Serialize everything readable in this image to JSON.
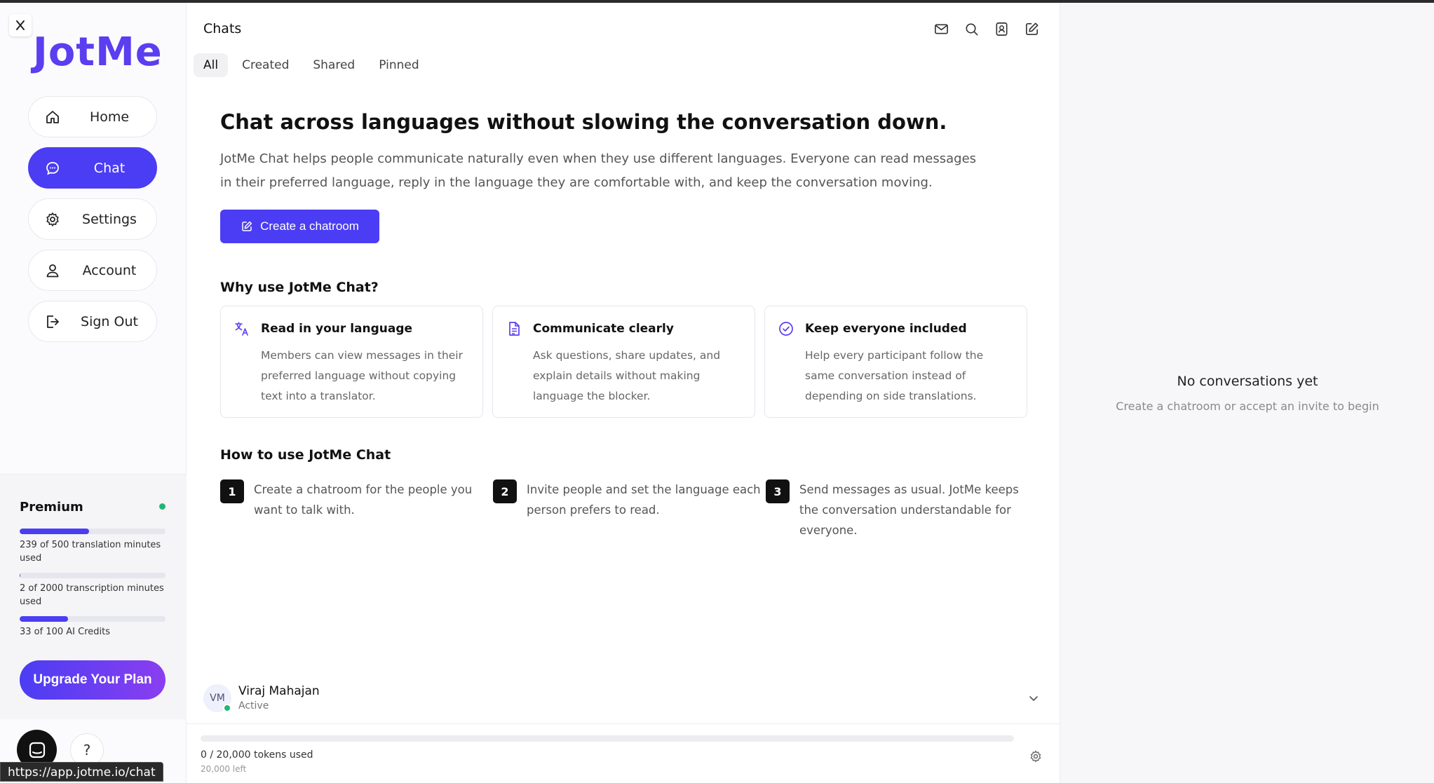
{
  "sidebar": {
    "logo": "JotMe",
    "nav": [
      {
        "label": "Home"
      },
      {
        "label": "Chat"
      },
      {
        "label": "Settings"
      },
      {
        "label": "Account"
      },
      {
        "label": "Sign Out"
      }
    ],
    "plan": {
      "title": "Premium",
      "usage": [
        {
          "label": "239 of 500 translation minutes used",
          "fraction": 0.478
        },
        {
          "label": "2 of 2000 transcription minutes used",
          "fraction": 0.001
        },
        {
          "label": "33 of 100 AI Credits",
          "fraction": 0.33
        }
      ],
      "upgrade_label": "Upgrade Your Plan"
    },
    "help_label": "?",
    "url_tooltip": "https://app.jotme.io/chat"
  },
  "main": {
    "title": "Chats",
    "tabs": [
      "All",
      "Created",
      "Shared",
      "Pinned"
    ],
    "hero_title": "Chat across languages without slowing the conversation down.",
    "intro": "JotMe Chat helps people communicate naturally even when they use different languages. Everyone can read messages in their preferred language, reply in the language they are comfortable with, and keep the conversation moving.",
    "create_label": "Create a chatroom",
    "why_title": "Why use JotMe Chat?",
    "features": [
      {
        "title": "Read in your language",
        "body": "Members can view messages in their preferred language without copying text into a translator."
      },
      {
        "title": "Communicate clearly",
        "body": "Ask questions, share updates, and explain details without making language the blocker."
      },
      {
        "title": "Keep everyone included",
        "body": "Help every participant follow the same conversation instead of depending on side translations."
      }
    ],
    "how_title": "How to use JotMe Chat",
    "steps": [
      {
        "num": "1",
        "text": "Create a chatroom for the people you want to talk with."
      },
      {
        "num": "2",
        "text": "Invite people and set the language each person prefers to read."
      },
      {
        "num": "3",
        "text": "Send messages as usual. JotMe keeps the conversation understandable for everyone."
      }
    ],
    "user": {
      "initials": "VM",
      "name": "Viraj Mahajan",
      "status": "Active"
    },
    "tokens": {
      "used_label": "0 / 20,000 tokens used",
      "left_label": "20,000 left",
      "fraction": 0
    }
  },
  "right": {
    "empty_title": "No conversations yet",
    "empty_sub": "Create a chatroom or accept an invite to begin"
  },
  "colors": {
    "accent": "#4b3df3",
    "status_green": "#22b573"
  }
}
